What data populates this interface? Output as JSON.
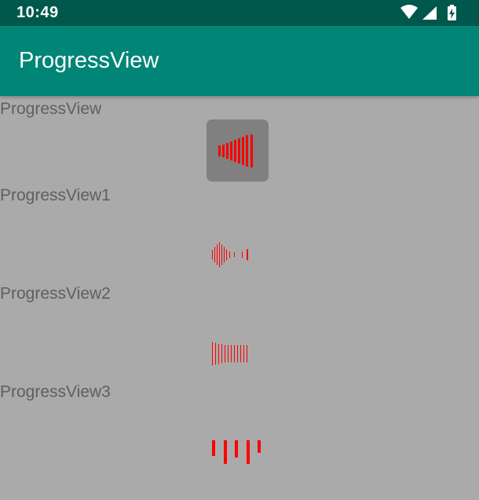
{
  "status_bar": {
    "time": "10:49",
    "icons": [
      "wifi-icon",
      "cellular-signal-icon",
      "battery-charging-icon"
    ]
  },
  "app_bar": {
    "title": "ProgressView"
  },
  "sections": [
    {
      "label": "ProgressView"
    },
    {
      "label": "ProgressView1"
    },
    {
      "label": "ProgressView2"
    },
    {
      "label": "ProgressView3"
    }
  ],
  "colors": {
    "status_bar": "#00574b",
    "app_bar": "#008577",
    "background": "#aaaaaa",
    "indicator": "#ff0000",
    "loader_box": "#808080"
  }
}
